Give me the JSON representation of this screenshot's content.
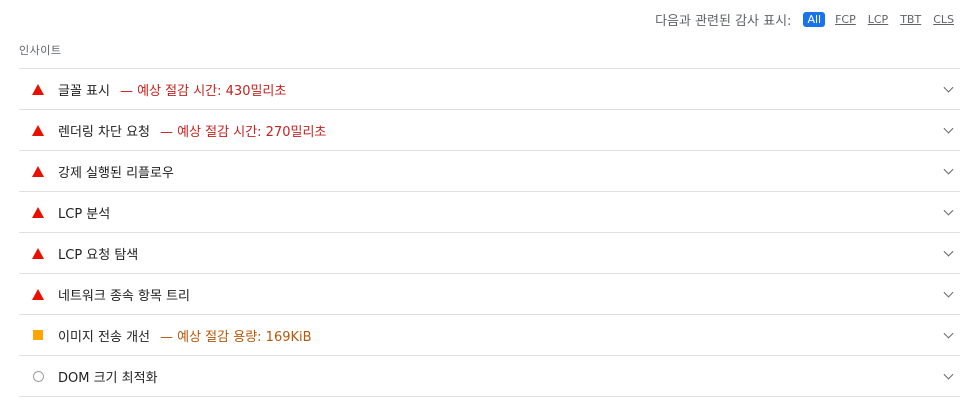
{
  "filter_bar": {
    "label": "다음과 관련된 감사 표시:",
    "options": [
      "All",
      "FCP",
      "LCP",
      "TBT",
      "CLS"
    ],
    "active": "All"
  },
  "section": {
    "title": "인사이트"
  },
  "insights": [
    {
      "status": "fail",
      "title": "글꼴 표시",
      "savings": "— 예상 절감 시간: 430밀리초",
      "savings_color": "red"
    },
    {
      "status": "fail",
      "title": "렌더링 차단 요청",
      "savings": "— 예상 절감 시간: 270밀리초",
      "savings_color": "red"
    },
    {
      "status": "fail",
      "title": "강제 실행된 리플로우",
      "savings": "",
      "savings_color": ""
    },
    {
      "status": "fail",
      "title": "LCP 분석",
      "savings": "",
      "savings_color": ""
    },
    {
      "status": "fail",
      "title": "LCP 요청 탐색",
      "savings": "",
      "savings_color": ""
    },
    {
      "status": "fail",
      "title": "네트워크 종속 항목 트리",
      "savings": "",
      "savings_color": ""
    },
    {
      "status": "average",
      "title": "이미지 전송 개선",
      "savings": "— 예상 절감 용량: 169KiB",
      "savings_color": "orange"
    },
    {
      "status": "info",
      "title": "DOM 크기 최적화",
      "savings": "",
      "savings_color": ""
    }
  ],
  "colors": {
    "fail": "#eb0f00",
    "average": "#ffa400",
    "info": "#9e9e9e",
    "accent": "#1a73e8"
  }
}
